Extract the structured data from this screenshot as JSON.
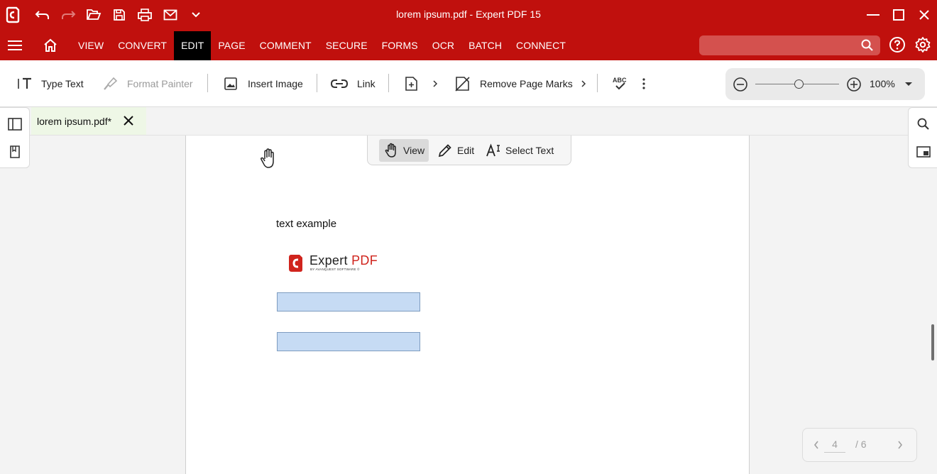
{
  "window": {
    "title": "lorem ipsum.pdf  -  Expert PDF 15"
  },
  "menu": {
    "tabs": [
      "VIEW",
      "CONVERT",
      "EDIT",
      "PAGE",
      "COMMENT",
      "SECURE",
      "FORMS",
      "OCR",
      "BATCH",
      "CONNECT"
    ],
    "active_tab": "EDIT",
    "search_placeholder": ""
  },
  "toolbar": {
    "type_text": "Type Text",
    "format_painter": "Format Painter",
    "insert_image": "Insert Image",
    "link": "Link",
    "remove_page_marks": "Remove Page Marks"
  },
  "zoom": {
    "value_label": "100%",
    "level": 0.5
  },
  "document_tab": {
    "label": "lorem ipsum.pdf*"
  },
  "mode_bar": {
    "view": "View",
    "edit": "Edit",
    "select_text": "Select Text",
    "active": "View"
  },
  "page_content": {
    "text": "text example",
    "logo_word": "Expert ",
    "logo_pdf": "PDF",
    "logo_sub": "BY AVANQUEST SOFTWARE ©"
  },
  "pager": {
    "current": "4",
    "total": "/ 6"
  },
  "colors": {
    "brand_red": "#c0100d",
    "field_fill": "#c6dbf4",
    "doc_tab": "#eef7e6"
  }
}
